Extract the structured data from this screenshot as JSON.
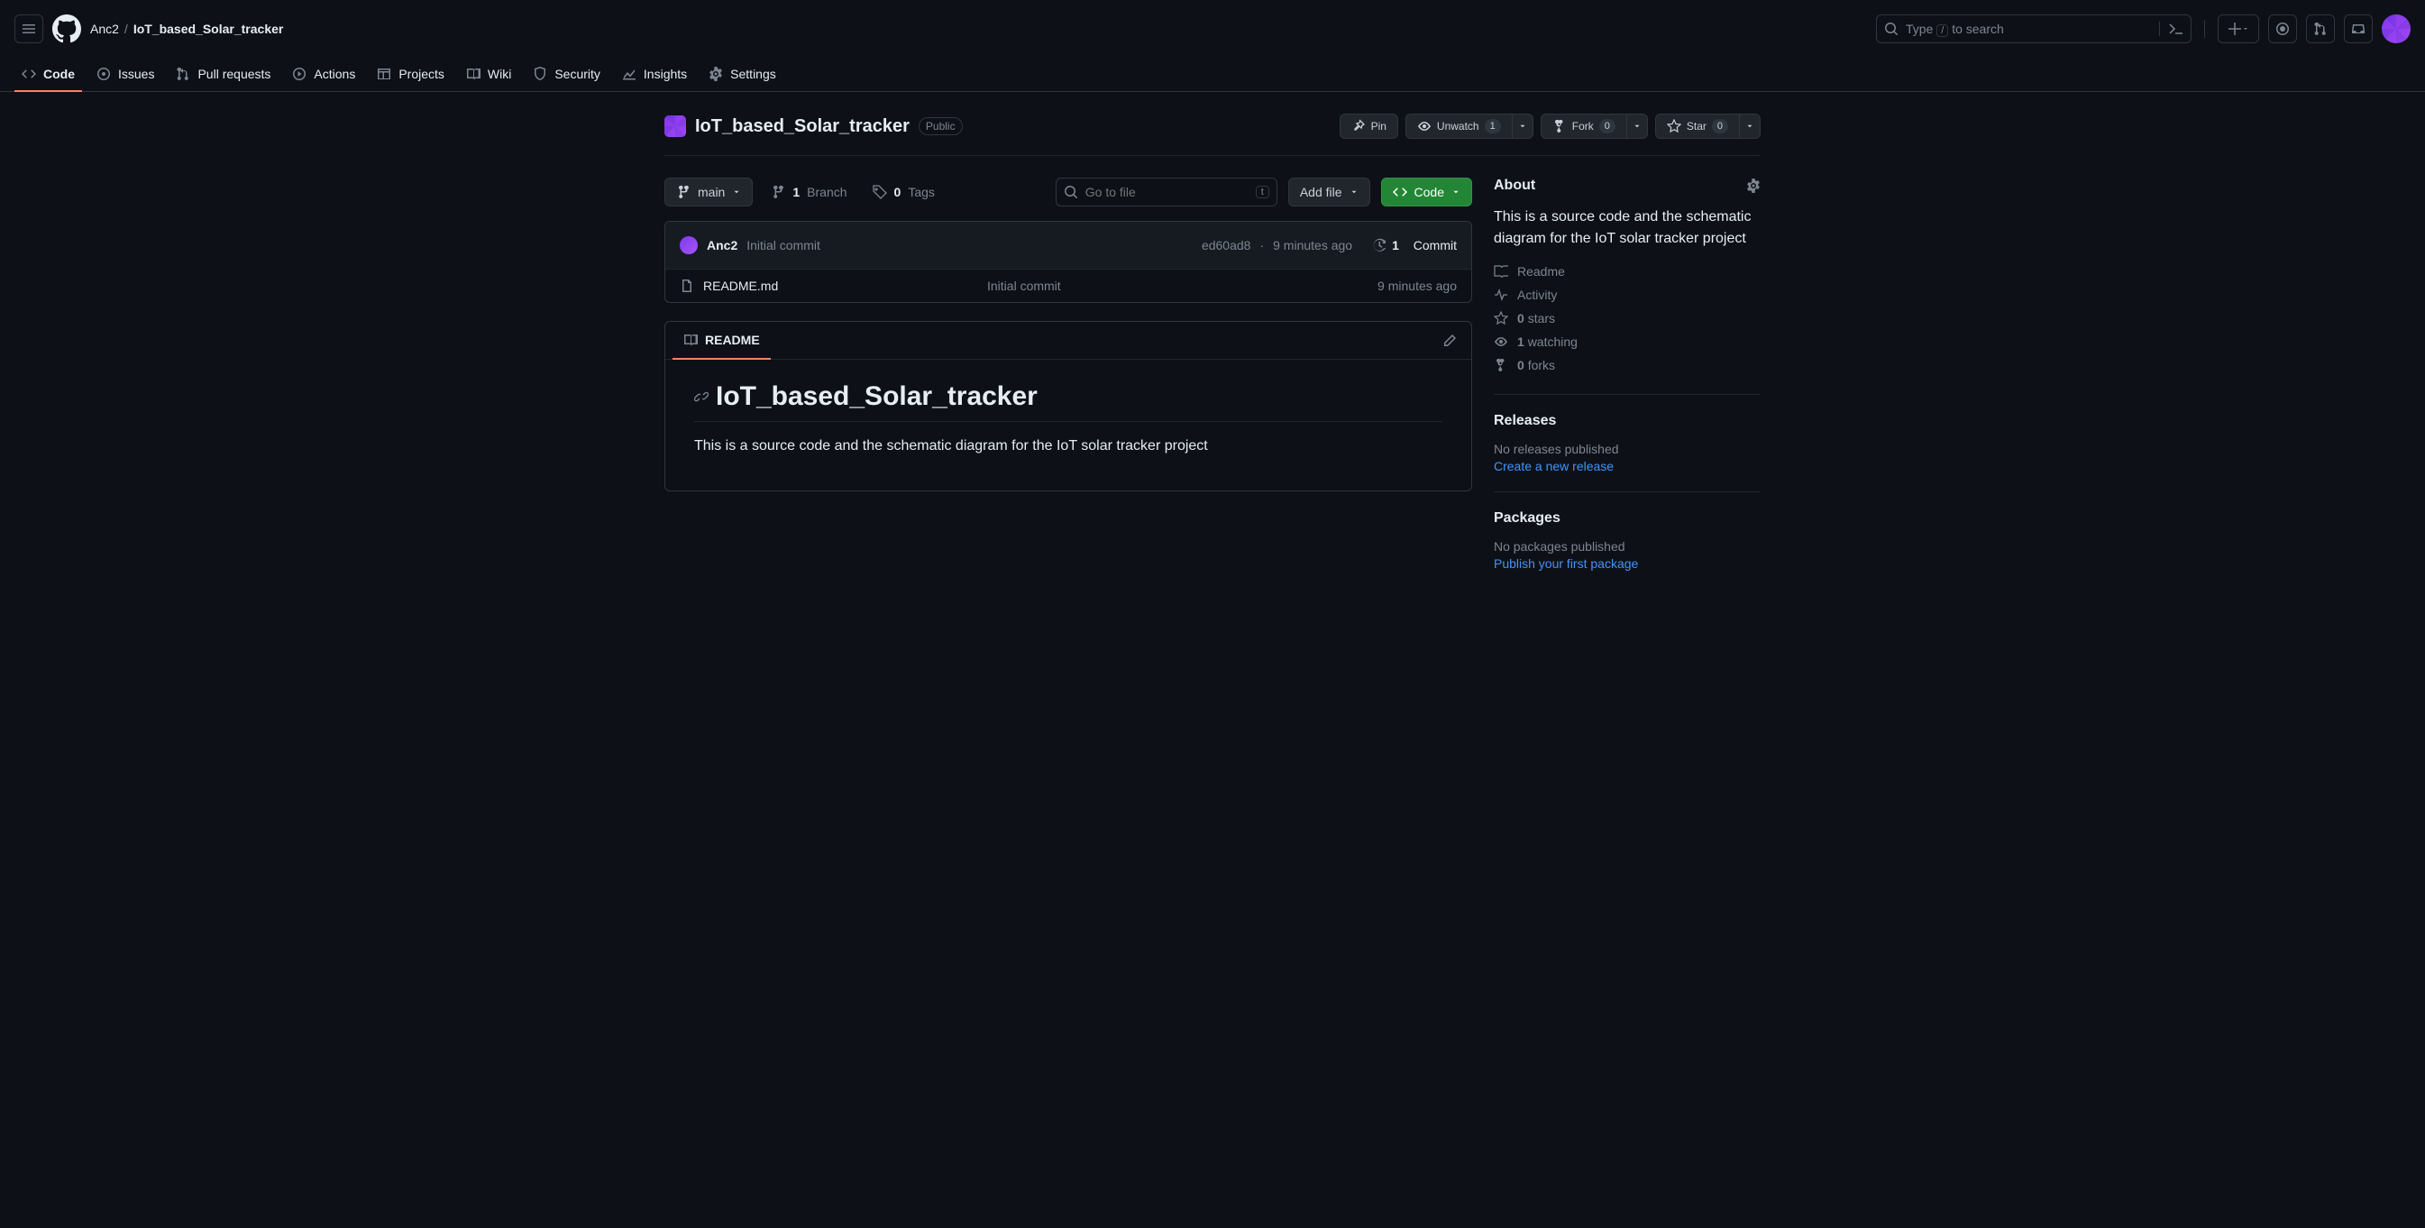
{
  "header": {
    "owner": "Anc2",
    "sep": "/",
    "repo": "IoT_based_Solar_tracker",
    "search_prefix": "Type",
    "search_key": "/",
    "search_suffix": "to search"
  },
  "tabs": {
    "code": "Code",
    "issues": "Issues",
    "pulls": "Pull requests",
    "actions": "Actions",
    "projects": "Projects",
    "wiki": "Wiki",
    "security": "Security",
    "insights": "Insights",
    "settings": "Settings"
  },
  "repo": {
    "name": "IoT_based_Solar_tracker",
    "visibility": "Public",
    "pin": "Pin",
    "unwatch": "Unwatch",
    "watch_count": "1",
    "fork": "Fork",
    "fork_count": "0",
    "star": "Star",
    "star_count": "0"
  },
  "files": {
    "branch": "main",
    "branch_count": "1",
    "branch_label": "Branch",
    "tag_count": "0",
    "tag_label": "Tags",
    "go_to_file": "Go to file",
    "go_key": "t",
    "add_file": "Add file",
    "code_btn": "Code"
  },
  "commit": {
    "author": "Anc2",
    "message": "Initial commit",
    "sha": "ed60ad8",
    "sep": "·",
    "time": "9 minutes ago",
    "count": "1",
    "count_label": "Commit"
  },
  "filelist": [
    {
      "name": "README.md",
      "msg": "Initial commit",
      "time": "9 minutes ago"
    }
  ],
  "readme": {
    "tab": "README",
    "heading": "IoT_based_Solar_tracker",
    "body": "This is a source code and the schematic diagram for the IoT solar tracker project"
  },
  "about": {
    "title": "About",
    "desc": "This is a source code and the schematic diagram for the IoT solar tracker project",
    "readme": "Readme",
    "activity": "Activity",
    "stars_n": "0",
    "stars_l": "stars",
    "watch_n": "1",
    "watch_l": "watching",
    "forks_n": "0",
    "forks_l": "forks"
  },
  "releases": {
    "title": "Releases",
    "none": "No releases published",
    "create": "Create a new release"
  },
  "packages": {
    "title": "Packages",
    "none": "No packages published",
    "publish": "Publish your first package"
  }
}
